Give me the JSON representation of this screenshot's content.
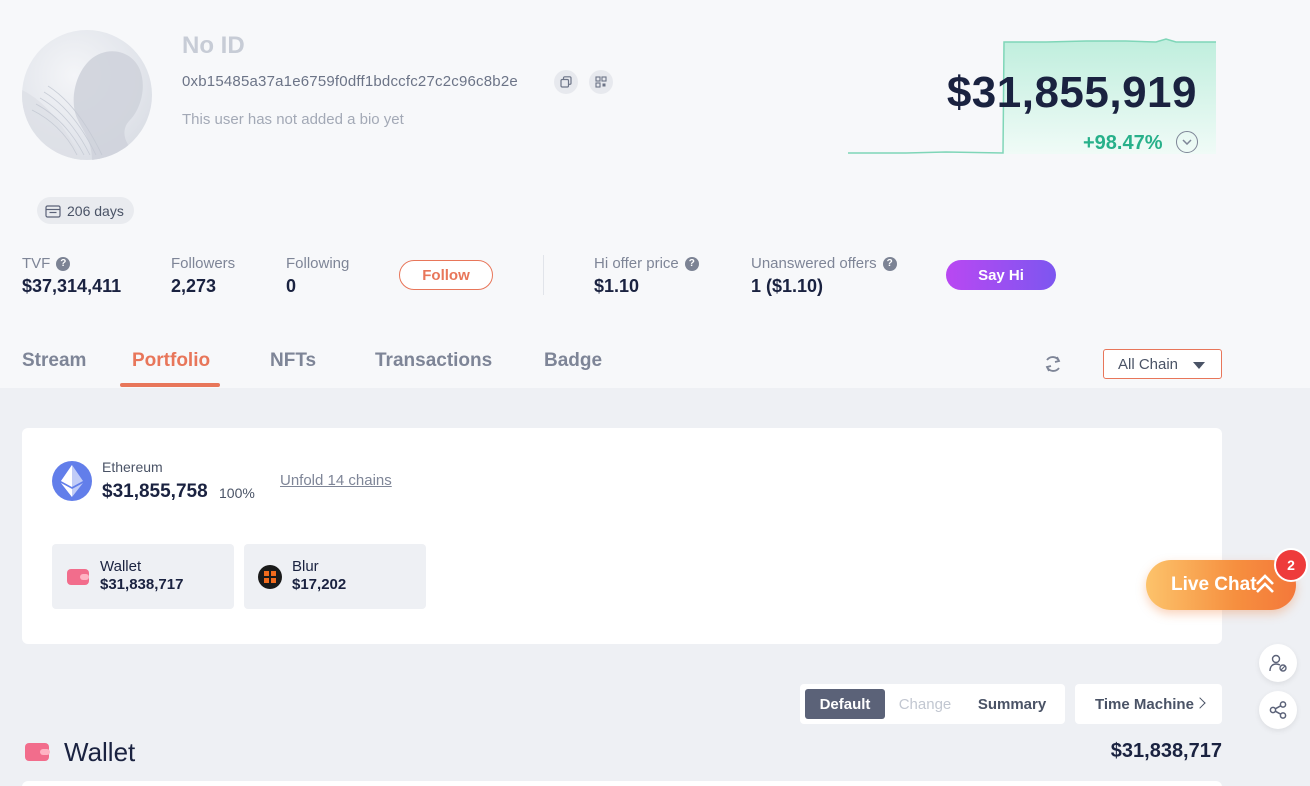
{
  "profile": {
    "name": "No ID",
    "address": "0xb15485a37a1e6759f0dff1bdccfc27c2c96c8b2e",
    "bio": "This user has not added a bio yet",
    "days": "206 days"
  },
  "stats": {
    "tvf_label": "TVF",
    "tvf_value": "$37,314,411",
    "followers_label": "Followers",
    "followers_value": "2,273",
    "following_label": "Following",
    "following_value": "0",
    "follow_button": "Follow",
    "hi_offer_label": "Hi offer price",
    "hi_offer_value": "$1.10",
    "unanswered_label": "Unanswered offers",
    "unanswered_value": "1 ($1.10)",
    "say_hi_button": "Say Hi",
    "question_mark": "?"
  },
  "networth": {
    "total": "$31,855,919",
    "change": "+98.47%",
    "colors": {
      "up": "#27b08a",
      "spark_fill": "#d6f5ea"
    }
  },
  "tabs": [
    {
      "label": "Stream",
      "active": false
    },
    {
      "label": "Portfolio",
      "active": true
    },
    {
      "label": "NFTs",
      "active": false
    },
    {
      "label": "Transactions",
      "active": false
    },
    {
      "label": "Badge",
      "active": false
    }
  ],
  "chain_filter": {
    "selected": "All Chain"
  },
  "chain_card": {
    "chain_name": "Ethereum",
    "chain_value": "$31,855,758",
    "chain_pct": "100%",
    "unfold_link": "Unfold 14 chains",
    "protocols": [
      {
        "name": "Wallet",
        "value": "$31,838,717",
        "icon": "wallet-icon"
      },
      {
        "name": "Blur",
        "value": "$17,202",
        "icon": "blur-logo-icon"
      }
    ]
  },
  "view_modes": {
    "default": "Default",
    "change": "Change",
    "summary": "Summary",
    "time_machine": "Time Machine"
  },
  "wallet_section": {
    "title": "Wallet",
    "total": "$31,838,717"
  },
  "live_chat": {
    "label": "Live Chat",
    "badge": "2"
  },
  "accent_color": "#e8765a"
}
